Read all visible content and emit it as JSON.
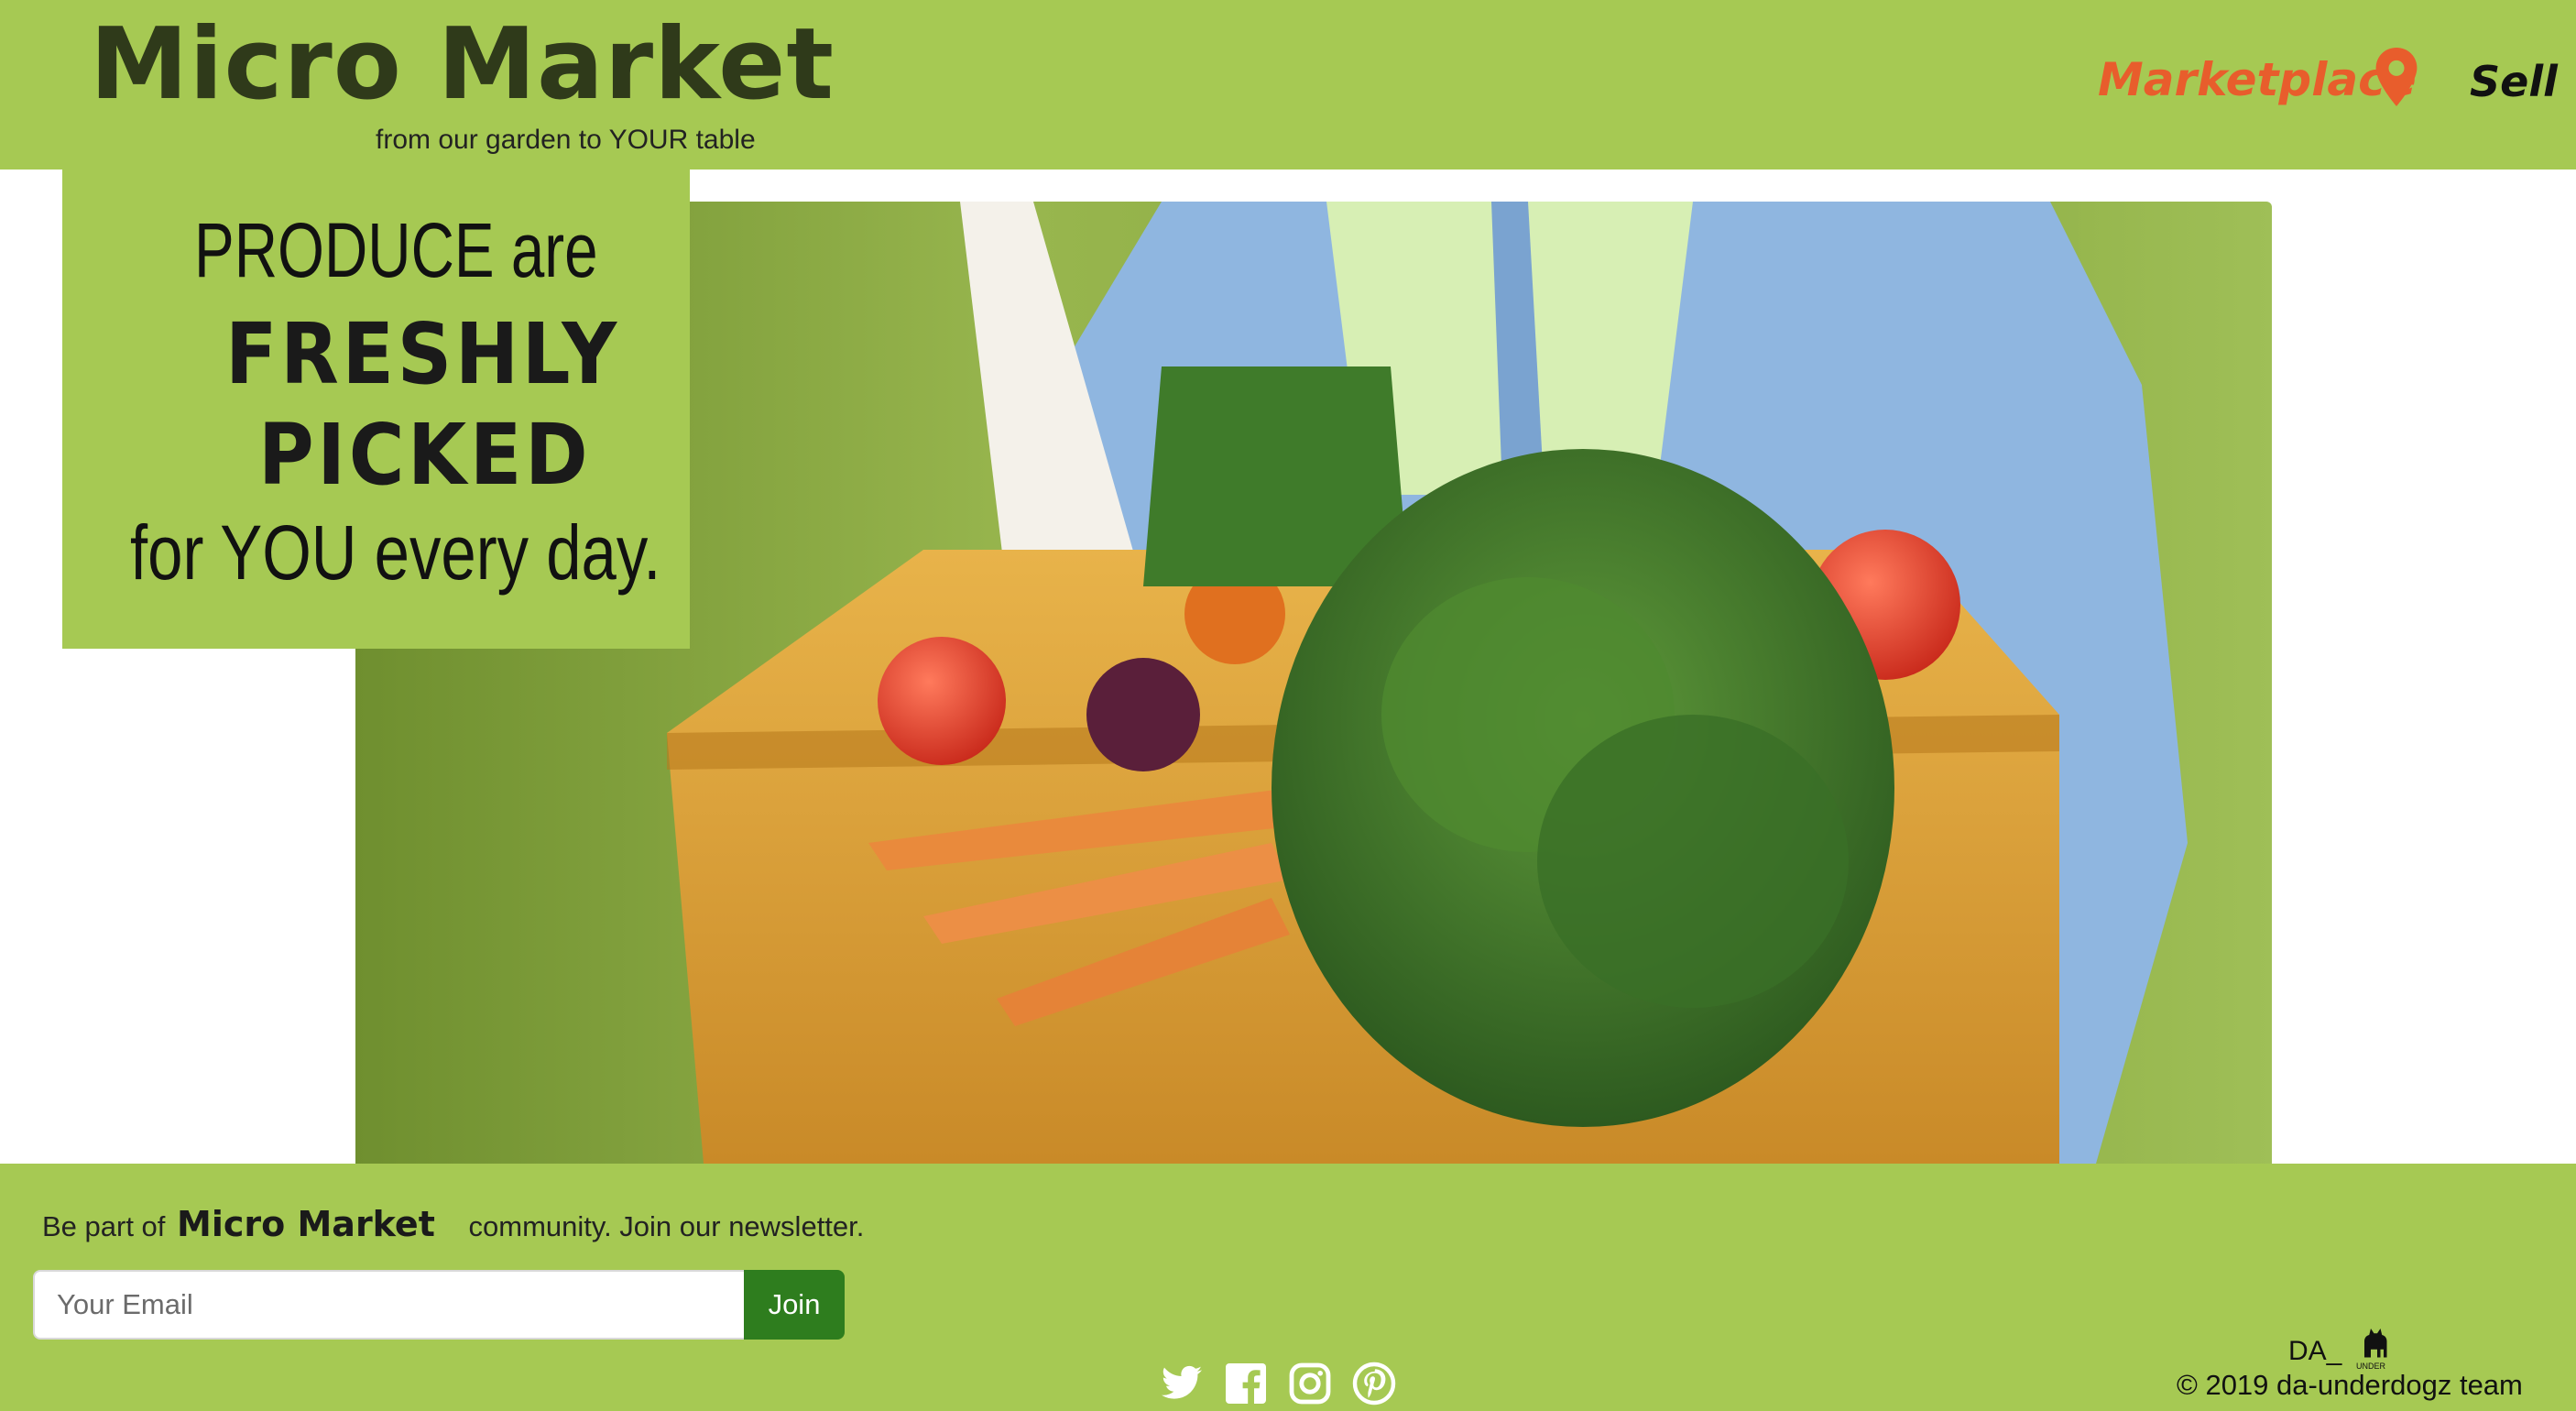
{
  "header": {
    "brand": "Micro Market",
    "tagline": "from our garden to YOUR table",
    "nav": {
      "marketplace": "Marketplace",
      "sell": "Sell"
    }
  },
  "hero": {
    "promo": {
      "line1": "PRODUCE are",
      "line2": "FRESHLY",
      "line3": "PICKED",
      "line4": "for YOU every day."
    }
  },
  "footer": {
    "newsletter": {
      "prefix": "Be part of",
      "brand": "Micro Market",
      "suffix": "community. Join our newsletter.",
      "email_placeholder": "Your Email",
      "join_label": "Join"
    },
    "social": [
      "twitter-icon",
      "facebook-icon",
      "instagram-icon",
      "pinterest-icon"
    ],
    "team_logo_text": "DA_",
    "team_logo_sub": "UNDER",
    "copyright": "© 2019 da-underdogz team"
  },
  "colors": {
    "brand_green": "#a6c953",
    "accent_orange": "#e85d2c",
    "join_button": "#2e7d1e"
  }
}
